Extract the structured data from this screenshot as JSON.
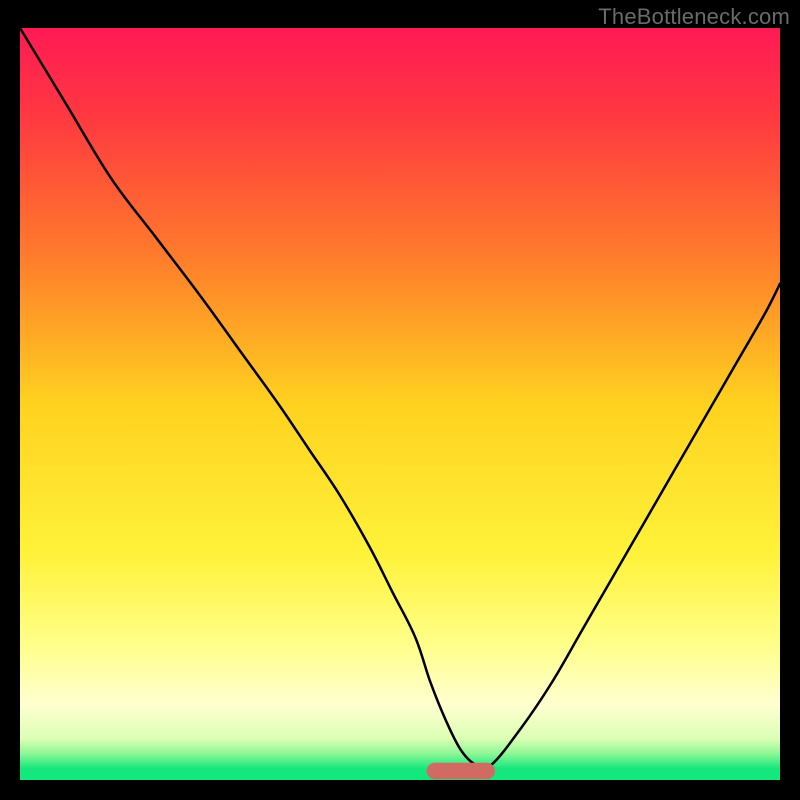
{
  "watermark": "TheBottleneck.com",
  "chart_data": {
    "type": "line",
    "title": "",
    "xlabel": "",
    "ylabel": "",
    "xlim": [
      0,
      100
    ],
    "ylim": [
      0,
      100
    ],
    "background_gradient": {
      "stops": [
        {
          "offset": 0.0,
          "color": "#ff1a55"
        },
        {
          "offset": 0.12,
          "color": "#ff3940"
        },
        {
          "offset": 0.3,
          "color": "#ff7a2c"
        },
        {
          "offset": 0.5,
          "color": "#ffd21f"
        },
        {
          "offset": 0.7,
          "color": "#fff23a"
        },
        {
          "offset": 0.82,
          "color": "#ffff8a"
        },
        {
          "offset": 0.9,
          "color": "#ffffd0"
        },
        {
          "offset": 0.945,
          "color": "#dcffb4"
        },
        {
          "offset": 0.965,
          "color": "#8cf796"
        },
        {
          "offset": 0.985,
          "color": "#14e87c"
        },
        {
          "offset": 1.0,
          "color": "#14e87c"
        }
      ]
    },
    "series": [
      {
        "name": "bottleneck-curve",
        "color": "#000000",
        "x": [
          0,
          6,
          12,
          18,
          24,
          29,
          34,
          38,
          42,
          46,
          49,
          52,
          54,
          56,
          58,
          60,
          62,
          66,
          70,
          74,
          78,
          82,
          86,
          90,
          94,
          98,
          100
        ],
        "y": [
          100,
          90,
          80,
          72,
          64,
          57,
          50,
          44,
          38,
          31,
          25,
          19,
          13,
          8,
          4,
          2,
          2,
          7,
          13,
          20,
          27,
          34,
          41,
          48,
          55,
          62,
          66
        ]
      }
    ],
    "marker": {
      "name": "optimal-zone",
      "color": "#d16a63",
      "x_center": 58,
      "width": 9,
      "y": 1.2,
      "height": 2.2,
      "rx": 50
    }
  }
}
